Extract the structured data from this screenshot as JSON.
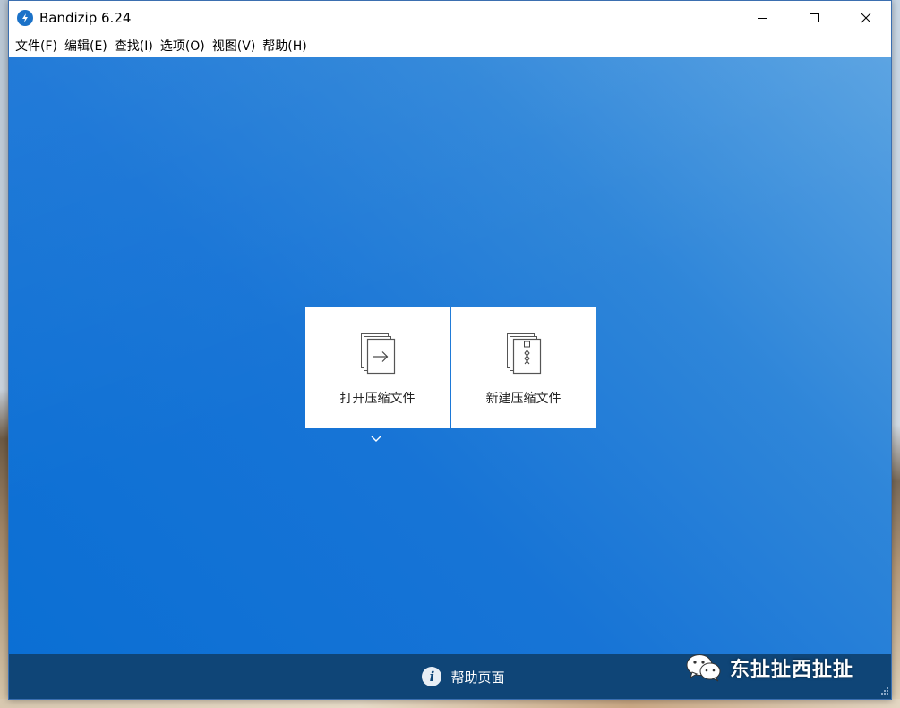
{
  "window": {
    "title": "Bandizip 6.24",
    "app_icon": "bandizip-logo-icon",
    "controls": [
      "minimize-icon",
      "maximize-icon",
      "close-icon"
    ]
  },
  "menubar": {
    "items": [
      {
        "label": "文件(F)"
      },
      {
        "label": "编辑(E)"
      },
      {
        "label": "查找(I)"
      },
      {
        "label": "选项(O)"
      },
      {
        "label": "视图(V)"
      },
      {
        "label": "帮助(H)"
      }
    ]
  },
  "main": {
    "tiles": [
      {
        "label": "打开压缩文件",
        "icon": "open-archive-icon"
      },
      {
        "label": "新建压缩文件",
        "icon": "new-archive-icon"
      }
    ],
    "dropdown_icon": "chevron-down-icon"
  },
  "footer": {
    "help_label": "帮助页面",
    "icon": "info-icon"
  },
  "watermark": {
    "text": "东扯扯西扯扯",
    "icon": "wechat-icon"
  },
  "colors": {
    "client_bg": "#1774d6",
    "footer_bg": "#0f4577",
    "accent": "#1b72c8"
  }
}
